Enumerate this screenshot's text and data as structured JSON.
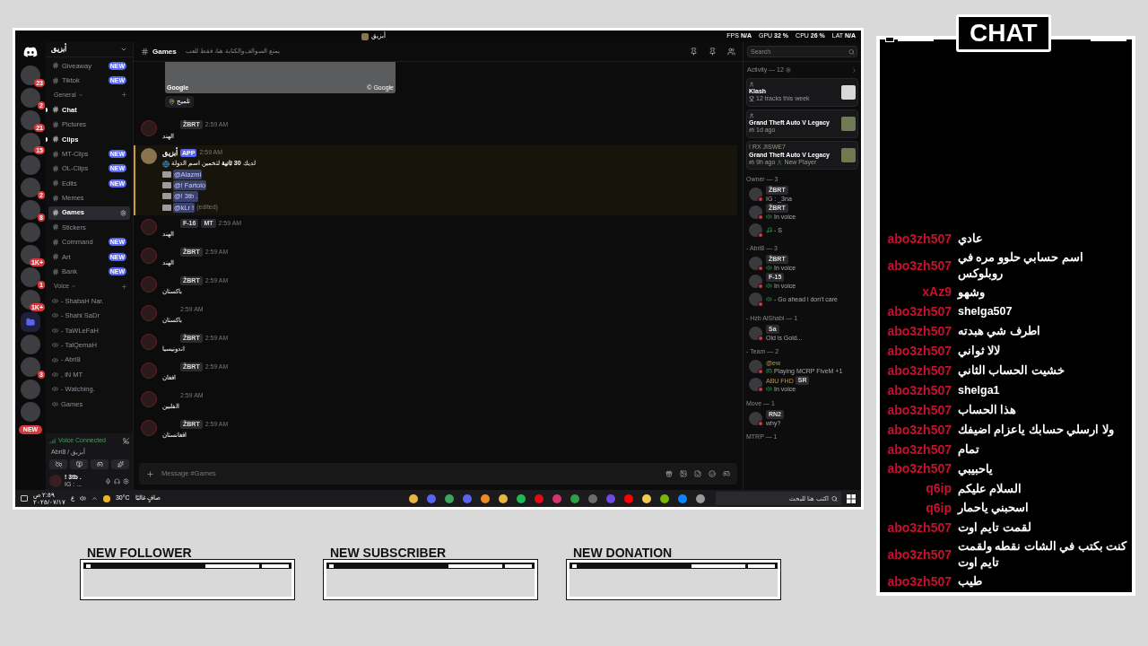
{
  "window": {
    "title": "أبزيق",
    "stats": [
      {
        "label": "FPS",
        "value": "N/A"
      },
      {
        "label": "GPU",
        "value": "32 %"
      },
      {
        "label": "CPU",
        "value": "26 %"
      },
      {
        "label": "LAT",
        "value": "N/A"
      }
    ]
  },
  "servers": [
    {
      "kind": "server",
      "badge": "23"
    },
    {
      "kind": "server",
      "badge": "2"
    },
    {
      "kind": "server",
      "badge": "21"
    },
    {
      "kind": "server",
      "badge": "15"
    },
    {
      "kind": "server"
    },
    {
      "kind": "server",
      "badge": "2"
    },
    {
      "kind": "server",
      "badge": "8"
    },
    {
      "kind": "server"
    },
    {
      "kind": "server",
      "badge": "1K+"
    },
    {
      "kind": "server",
      "badge": "1"
    },
    {
      "kind": "server",
      "badge": "1K+"
    },
    {
      "kind": "folder"
    },
    {
      "kind": "server"
    },
    {
      "kind": "server",
      "badge": "3"
    },
    {
      "kind": "server"
    },
    {
      "kind": "server"
    }
  ],
  "servers_new": "NEW",
  "sidebar": {
    "server_name": "أبزيق",
    "items": [
      {
        "kind": "channel",
        "name": "Giveaway",
        "badge": "NEW",
        "unread": false,
        "selected": false
      },
      {
        "kind": "channel",
        "name": "Tiktok",
        "badge": "NEW",
        "unread": false,
        "selected": false
      },
      {
        "kind": "category",
        "name": "General"
      },
      {
        "kind": "channel",
        "name": "Chat",
        "unread": true,
        "selected": false
      },
      {
        "kind": "channel",
        "name": "Pictures",
        "unread": false,
        "selected": false
      },
      {
        "kind": "channel",
        "name": "Clips",
        "unread": true,
        "selected": false
      },
      {
        "kind": "channel",
        "name": "MT-Clips",
        "badge": "NEW",
        "unread": false,
        "selected": false
      },
      {
        "kind": "channel",
        "name": "OL-Clips",
        "badge": "NEW",
        "unread": false,
        "selected": false
      },
      {
        "kind": "channel",
        "name": "Edits",
        "badge": "NEW",
        "unread": false,
        "selected": false
      },
      {
        "kind": "channel",
        "name": "Memes",
        "unread": false,
        "selected": false
      },
      {
        "kind": "channel",
        "name": "Games",
        "unread": false,
        "selected": true
      },
      {
        "kind": "channel",
        "name": "Stickers",
        "unread": false,
        "selected": false
      },
      {
        "kind": "channel",
        "name": "Command",
        "badge": "NEW",
        "unread": false,
        "selected": false
      },
      {
        "kind": "channel",
        "name": "Art",
        "badge": "NEW",
        "unread": false,
        "selected": false
      },
      {
        "kind": "channel",
        "name": "Bank",
        "badge": "NEW",
        "unread": false,
        "selected": false
      },
      {
        "kind": "category",
        "name": "Voice"
      },
      {
        "kind": "voice",
        "name": "- ShabaH Nar."
      },
      {
        "kind": "voice",
        "name": "- Shahi SaDr"
      },
      {
        "kind": "voice",
        "name": "- TaWLeFaH"
      },
      {
        "kind": "voice",
        "name": "- TalQemaH"
      },
      {
        "kind": "voice",
        "name": "- Abri8"
      },
      {
        "kind": "voice",
        "name": ", iN MT"
      },
      {
        "kind": "voice",
        "name": "- Watching."
      },
      {
        "kind": "voice",
        "name": "Games"
      }
    ],
    "voice_status": "Voice Connected",
    "voice_location": "Abri8 / أبزيق",
    "user": {
      "name": "! 3tb .",
      "status": "IG : ..."
    }
  },
  "main": {
    "channel": "Games",
    "topic": "يمنع السوالف والكتابة هنا، فقط للعب",
    "map": {
      "attribution": "Google",
      "copyright": "© Google",
      "hint": "تلميح"
    },
    "messages": [
      {
        "kind": "user",
        "badges": [
          "ŽBRT"
        ],
        "time": "2:59 AM",
        "text": "الهند"
      },
      {
        "kind": "bot",
        "author": "أبزيق",
        "tag": "APP",
        "time": "2:59 AM",
        "text": "لديك **30 ثانية** لتخمين اسم الدولة",
        "mentions": [
          "@Alazmi",
          "@! Fartolo",
          "@! 3tb .",
          "@kLr !"
        ],
        "edited": "(edited)"
      },
      {
        "kind": "user",
        "badges": [
          "F-16",
          "MT"
        ],
        "time": "2:59 AM",
        "text": "الهند"
      },
      {
        "kind": "user",
        "badges": [
          "ŽBRT"
        ],
        "time": "2:59 AM",
        "text": "الهند"
      },
      {
        "kind": "user",
        "badges": [
          "ŽBRT"
        ],
        "time": "2:59 AM",
        "text": "باكستان"
      },
      {
        "kind": "user",
        "time": "2:59 AM",
        "text": "باكستان"
      },
      {
        "kind": "user",
        "badges": [
          "ŽBRT"
        ],
        "time": "2:59 AM",
        "text": "اندونيسيا"
      },
      {
        "kind": "user",
        "badges": [
          "ŽBRT"
        ],
        "time": "2:59 AM",
        "text": "افغان"
      },
      {
        "kind": "user",
        "time": "2:59 AM",
        "text": "الفلبين"
      },
      {
        "kind": "user",
        "badges": [
          "ŽBRT"
        ],
        "time": "2:59 AM",
        "text": "افغانستان"
      }
    ],
    "input": {
      "placeholder": "Message #Games"
    }
  },
  "members": {
    "search": {
      "placeholder": "Search"
    },
    "activity": "Activity — 12",
    "cards": [
      {
        "kind": "music",
        "title": "Klash",
        "detail": "12 tracks this week"
      },
      {
        "kind": "game",
        "title": "Grand Theft Auto V Legacy",
        "detail": "1d ago"
      },
      {
        "kind": "game",
        "user": "! RX JISWE7",
        "title": "Grand Theft Auto V Legacy",
        "detail": "9h ago",
        "extra": "New Player"
      }
    ],
    "groups": [
      {
        "name": "Owner — 3",
        "members": [
          {
            "badge": "ŽBRT",
            "kind": "text",
            "status": "IG : _3na"
          },
          {
            "badge": "ŽBRT",
            "kind": "voice",
            "status": "In voice"
          },
          {
            "kind": "music",
            "status": "- S"
          }
        ]
      },
      {
        "name": "- Abri8 — 3",
        "members": [
          {
            "badge": "ŽBRT",
            "kind": "voice",
            "status": "In voice"
          },
          {
            "badge": "F-15",
            "kind": "voice",
            "status": "In voice"
          },
          {
            "kind": "voice",
            "status": "- Go ahead i don't care"
          }
        ]
      },
      {
        "name": "- Hzb AlShabi — 1",
        "members": [
          {
            "badge": "Sa",
            "kind": "text",
            "status": "Old is Gold..."
          }
        ]
      },
      {
        "name": "- Team — 2",
        "members": [
          {
            "name": "@ew",
            "kind": "game",
            "status": "Playing MCRP FiveM +1"
          },
          {
            "name": "ABU FHD",
            "badge": "SR",
            "kind": "voice",
            "status": "In voice"
          }
        ]
      },
      {
        "name": "Move — 1",
        "members": [
          {
            "badge": "RN2",
            "kind": "text",
            "status": "why?"
          }
        ]
      },
      {
        "name": "MTRP — 1"
      }
    ]
  },
  "taskbar": {
    "lang": "ع",
    "time": "٢:٥٩ ص",
    "date": "٢٠٢٥/٠٧/١٧",
    "temp": "30°C",
    "weather": "صافٍ غالبًا",
    "search": {
      "placeholder": "اكتب هنا للبحث"
    },
    "apps": [
      {
        "color": "#e8b640"
      },
      {
        "color": "#5865f2"
      },
      {
        "color": "#3ba55c"
      },
      {
        "color": "#5865f2"
      },
      {
        "color": "#f08a24"
      },
      {
        "color": "#e8b640"
      },
      {
        "color": "#1db954"
      },
      {
        "color": "#e50914"
      },
      {
        "color": "#d6336c"
      },
      {
        "color": "#2f9e44"
      },
      {
        "color": "#6b6b6b"
      },
      {
        "color": "#7048e8"
      },
      {
        "color": "#ff0000"
      },
      {
        "color": "#f2c94c"
      },
      {
        "color": "#76b900"
      },
      {
        "color": "#0a84ff"
      },
      {
        "color": "#9a9a9a"
      }
    ]
  },
  "overlay": {
    "chat_title": "CHAT",
    "alerts": [
      {
        "title": "NEW FOLLOWER"
      },
      {
        "title": "NEW SUBSCRIBER"
      },
      {
        "title": "NEW DONATION"
      }
    ]
  },
  "chat": [
    {
      "user": "abo3zh507",
      "text": "عادي"
    },
    {
      "user": "abo3zh507",
      "text": "اسم حسابي حلوو مره في روبلوكس"
    },
    {
      "user": "xAz9",
      "text": "وشهو"
    },
    {
      "user": "abo3zh507",
      "text": "shelga507"
    },
    {
      "user": "abo3zh507",
      "text": "اطرف شي هبدته"
    },
    {
      "user": "abo3zh507",
      "text": "لالا ثواني"
    },
    {
      "user": "abo3zh507",
      "text": "خشيت الحساب الثاني"
    },
    {
      "user": "abo3zh507",
      "text": "shelga1"
    },
    {
      "user": "abo3zh507",
      "text": "هذا الحساب"
    },
    {
      "user": "abo3zh507",
      "text": "ولا ارسلي حسابك ياعزام اضيفك"
    },
    {
      "user": "abo3zh507",
      "text": "تمام"
    },
    {
      "user": "abo3zh507",
      "text": "ياحبيبي"
    },
    {
      "user": "q6ip",
      "text": "السلام عليكم"
    },
    {
      "user": "q6ip",
      "text": "اسحبني ياحمار"
    },
    {
      "user": "abo3zh507",
      "text": "لقمت تايم اوت"
    },
    {
      "user": "abo3zh507",
      "text": "كنت بكتب في الشات نقطه ولقمت تايم اوت"
    },
    {
      "user": "abo3zh507",
      "text": "طيب"
    }
  ]
}
